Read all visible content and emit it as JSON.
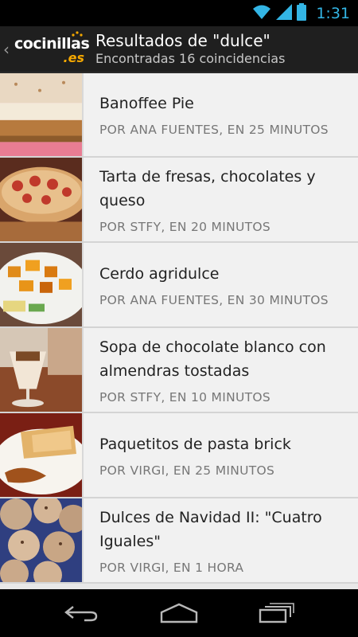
{
  "status_bar": {
    "time": "1:31",
    "icons": [
      "wifi-icon",
      "signal-icon",
      "battery-icon"
    ]
  },
  "action_bar": {
    "logo_word": "cocinillas",
    "logo_tld": ".es",
    "title": "Resultados de \"dulce\"",
    "subtitle": "Encontradas 16 coincidencias"
  },
  "results": [
    {
      "title": "Banoffee Pie",
      "meta": "POR ANA FUENTES, EN 25 MINUTOS"
    },
    {
      "title": "Tarta de fresas, chocolates y queso",
      "meta": "POR STFY, EN 20 MINUTOS"
    },
    {
      "title": "Cerdo agridulce",
      "meta": "POR ANA FUENTES, EN 30 MINUTOS"
    },
    {
      "title": "Sopa de chocolate blanco con almendras tostadas",
      "meta": "POR STFY, EN 10 MINUTOS"
    },
    {
      "title": "Paquetitos de pasta brick",
      "meta": "POR VIRGI, EN 25 MINUTOS"
    },
    {
      "title": "Dulces de Navidad II: \"Cuatro Iguales\"",
      "meta": "POR VIRGI, EN 1 HORA"
    }
  ],
  "nav_bar": {
    "buttons": [
      "back-icon",
      "home-icon",
      "recent-apps-icon"
    ]
  },
  "colors": {
    "accent": "#33b5e5",
    "brand_orange": "#f5a800",
    "action_bar": "#1f1f1f"
  }
}
